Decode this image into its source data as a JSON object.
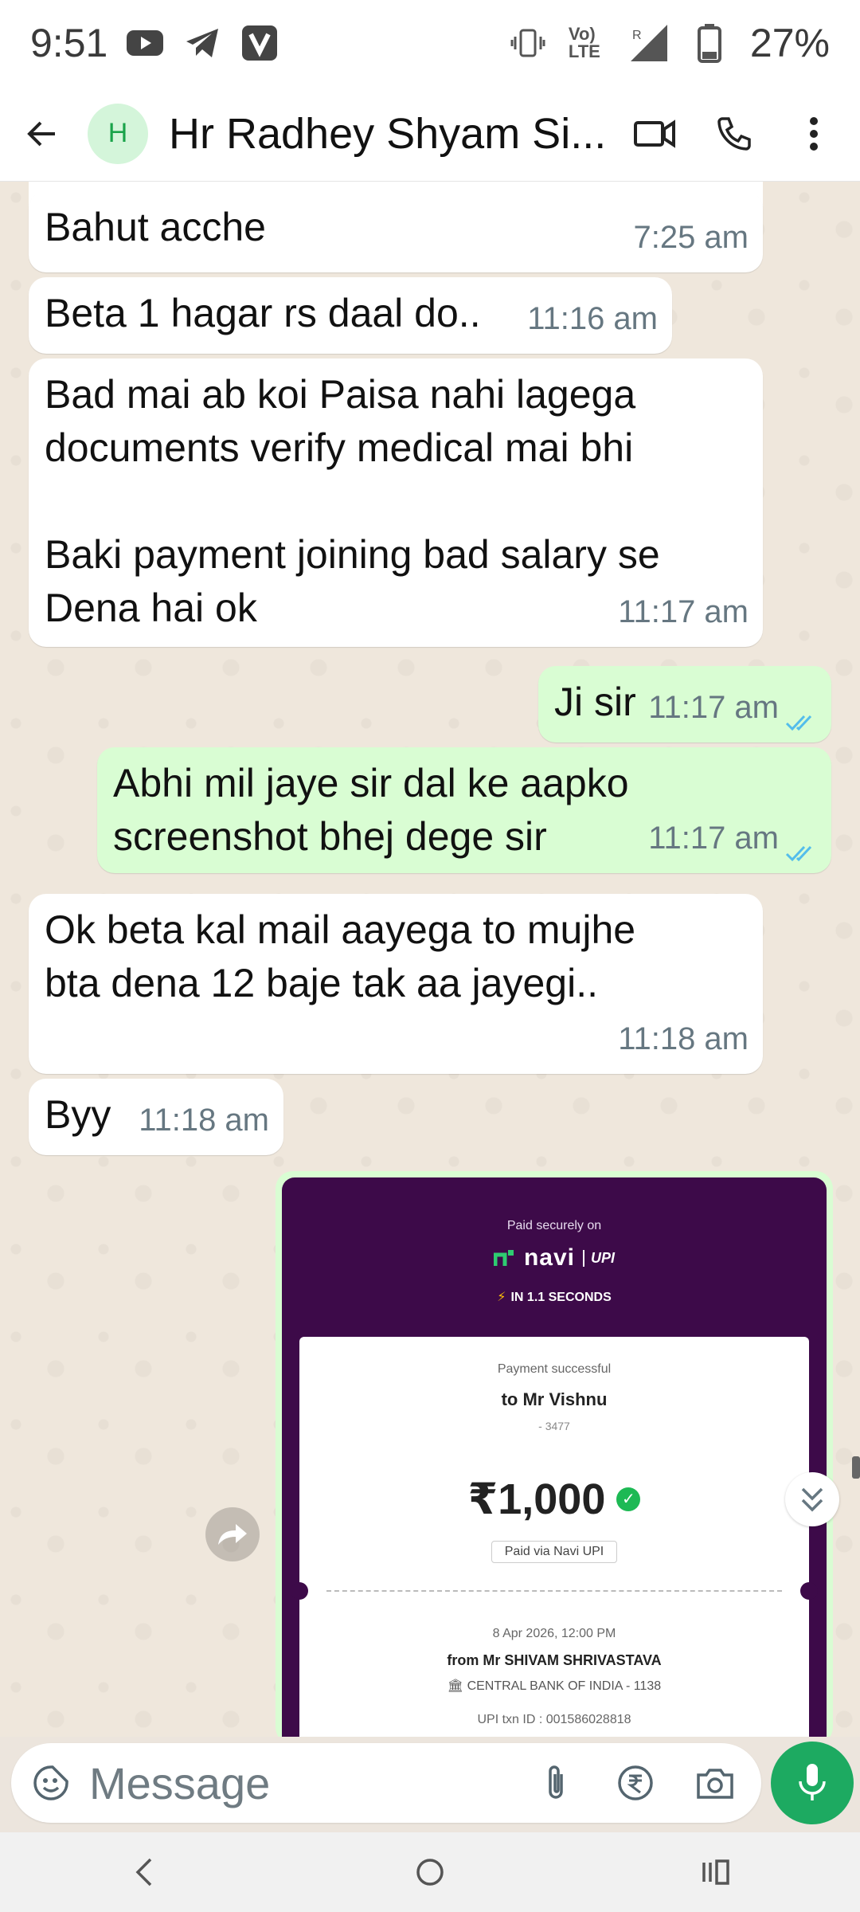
{
  "status_bar": {
    "time": "9:51",
    "battery": "27%",
    "network_label": "Vo) LTE",
    "icons": [
      "youtube-icon",
      "telegram-icon",
      "v-app-icon",
      "vibrate-icon",
      "volte-icon",
      "signal-icon",
      "battery-icon"
    ]
  },
  "header": {
    "avatar_initial": "H",
    "contact_name": "Hr Radhey Shyam Si...",
    "accent_color": "#1aa34a",
    "icons": [
      "back-arrow-icon",
      "video-call-icon",
      "voice-call-icon",
      "more-vert-icon"
    ]
  },
  "messages": [
    {
      "text": "Bahut acche",
      "time": "7:25 am",
      "direction": "in"
    },
    {
      "text": "Beta 1 hagar rs daal do..",
      "time": "11:16 am",
      "direction": "in"
    },
    {
      "text": "Bad mai ab koi Paisa nahi lagega\ndocuments verify medical mai bhi\n\nBaki payment joining bad salary se\nDena hai ok",
      "time": "11:17 am",
      "direction": "in"
    },
    {
      "text": "Ji sir",
      "time": "11:17 am",
      "direction": "out"
    },
    {
      "text": "Abhi mil jaye sir dal ke aapko\nscreenshot bhej dege sir",
      "time": "11:17 am",
      "direction": "out"
    },
    {
      "text": "Ok beta kal mail aayega to mujhe\nbta dena 12 baje tak aa jayegi..",
      "time": "11:18 am",
      "direction": "in"
    },
    {
      "text": "Byy",
      "time": "11:18 am",
      "direction": "in"
    }
  ],
  "receipt": {
    "paid_securely": "Paid securely on",
    "brand": "navi",
    "upi": "UPI",
    "speed": "IN 1.1 SECONDS",
    "status": "Payment successful",
    "to": "to Mr Vishnu",
    "account": "- 3477",
    "amount": "₹1,000",
    "via": "Paid via Navi UPI",
    "datetime": "8 Apr 2026, 12:00 PM",
    "from": "from Mr SHIVAM  SHRIVASTAVA",
    "bank": "CENTRAL BANK OF INDIA - 1138",
    "txn": "UPI txn ID : 001586028818",
    "bg_color": "#3d0a49",
    "success_color": "#1db954"
  },
  "composer": {
    "placeholder": "Message",
    "icons": [
      "emoji-sticker-icon",
      "attach-icon",
      "rupee-payment-icon",
      "camera-icon",
      "mic-icon"
    ],
    "mic_color": "#1daa61"
  },
  "colors": {
    "outgoing_bubble": "#d9fdd3",
    "incoming_bubble": "#ffffff",
    "read_tick": "#53bdeb"
  }
}
